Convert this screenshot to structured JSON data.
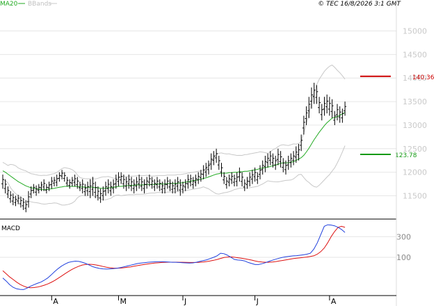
{
  "header": {
    "legend_ma": "MA20",
    "legend_bbands": "BBands",
    "copyright": "© TEC 16/8/2026 3:1 GMT"
  },
  "macd_label": "MACD",
  "colors": {
    "price_bars": "#000000",
    "ma20": "#22aa22",
    "bbands": "#c8c8c8",
    "resistance": "#cc0000",
    "support": "#119911",
    "macd_line": "#1f3fdd",
    "signal_line": "#dd1111",
    "grid": "#e6e6e6"
  },
  "chart_data": [
    {
      "type": "ohlc",
      "title": "",
      "xlabel": "",
      "ylabel": "",
      "ylim": [
        11050,
        15450
      ],
      "yticks": [
        "11500",
        "12000",
        "12500",
        "13000",
        "13500",
        "14000",
        "14500",
        "15000"
      ],
      "grid": true,
      "x_month_labels": [
        {
          "label": "A",
          "index": 19
        },
        {
          "label": "M",
          "index": 45
        },
        {
          "label": "J",
          "index": 70
        },
        {
          "label": "J",
          "index": 98
        },
        {
          "label": "A",
          "index": 127
        }
      ],
      "bars": [
        [
          11950,
          11650
        ],
        [
          11850,
          11550
        ],
        [
          11700,
          11450
        ],
        [
          11600,
          11350
        ],
        [
          11550,
          11300
        ],
        [
          11500,
          11280
        ],
        [
          11520,
          11320
        ],
        [
          11480,
          11250
        ],
        [
          11450,
          11200
        ],
        [
          11400,
          11150
        ],
        [
          11600,
          11250
        ],
        [
          11700,
          11450
        ],
        [
          11750,
          11550
        ],
        [
          11720,
          11500
        ],
        [
          11750,
          11550
        ],
        [
          11800,
          11600
        ],
        [
          11850,
          11600
        ],
        [
          11750,
          11550
        ],
        [
          11800,
          11600
        ],
        [
          11900,
          11650
        ],
        [
          11900,
          11700
        ],
        [
          11950,
          11700
        ],
        [
          12000,
          11800
        ],
        [
          12050,
          11850
        ],
        [
          12000,
          11800
        ],
        [
          11900,
          11700
        ],
        [
          11850,
          11650
        ],
        [
          11900,
          11700
        ],
        [
          11950,
          11700
        ],
        [
          11900,
          11650
        ],
        [
          11800,
          11600
        ],
        [
          11850,
          11550
        ],
        [
          11750,
          11500
        ],
        [
          11800,
          11500
        ],
        [
          11850,
          11450
        ],
        [
          11900,
          11500
        ],
        [
          11800,
          11450
        ],
        [
          11700,
          11400
        ],
        [
          11650,
          11350
        ],
        [
          11700,
          11400
        ],
        [
          11800,
          11500
        ],
        [
          11850,
          11550
        ],
        [
          11800,
          11500
        ],
        [
          11850,
          11550
        ],
        [
          11950,
          11650
        ],
        [
          12000,
          11700
        ],
        [
          12000,
          11750
        ],
        [
          11950,
          11650
        ],
        [
          11900,
          11600
        ],
        [
          11950,
          11650
        ],
        [
          11900,
          11600
        ],
        [
          11850,
          11550
        ],
        [
          11900,
          11600
        ],
        [
          11950,
          11650
        ],
        [
          11900,
          11600
        ],
        [
          11850,
          11550
        ],
        [
          11900,
          11650
        ],
        [
          11950,
          11700
        ],
        [
          11900,
          11650
        ],
        [
          11850,
          11600
        ],
        [
          11900,
          11650
        ],
        [
          11850,
          11600
        ],
        [
          11800,
          11550
        ],
        [
          11850,
          11550
        ],
        [
          11900,
          11650
        ],
        [
          11850,
          11600
        ],
        [
          11800,
          11550
        ],
        [
          11850,
          11550
        ],
        [
          11900,
          11600
        ],
        [
          11850,
          11500
        ],
        [
          11800,
          11550
        ],
        [
          11850,
          11600
        ],
        [
          11950,
          11650
        ],
        [
          11950,
          11700
        ],
        [
          11900,
          11650
        ],
        [
          11950,
          11700
        ],
        [
          12000,
          11750
        ],
        [
          12050,
          11800
        ],
        [
          12150,
          11850
        ],
        [
          12200,
          11900
        ],
        [
          12250,
          11950
        ],
        [
          12400,
          12050
        ],
        [
          12450,
          12150
        ],
        [
          12500,
          12200
        ],
        [
          12350,
          12050
        ],
        [
          12200,
          11900
        ],
        [
          12000,
          11750
        ],
        [
          11900,
          11650
        ],
        [
          11950,
          11700
        ],
        [
          12000,
          11750
        ],
        [
          11950,
          11700
        ],
        [
          12000,
          11700
        ],
        [
          12100,
          11800
        ],
        [
          12000,
          11700
        ],
        [
          11850,
          11600
        ],
        [
          11900,
          11650
        ],
        [
          12000,
          11700
        ],
        [
          12050,
          11750
        ],
        [
          12100,
          11800
        ],
        [
          12000,
          11750
        ],
        [
          12150,
          11850
        ],
        [
          12250,
          11950
        ],
        [
          12350,
          12000
        ],
        [
          12400,
          12100
        ],
        [
          12450,
          12150
        ],
        [
          12400,
          12100
        ],
        [
          12350,
          12050
        ],
        [
          12500,
          12150
        ],
        [
          12450,
          12100
        ],
        [
          12300,
          12000
        ],
        [
          12250,
          11950
        ],
        [
          12350,
          12050
        ],
        [
          12400,
          12100
        ],
        [
          12450,
          12150
        ],
        [
          12550,
          12200
        ],
        [
          12600,
          12250
        ],
        [
          12800,
          12450
        ],
        [
          13200,
          12800
        ],
        [
          13400,
          13000
        ],
        [
          13600,
          13150
        ],
        [
          13800,
          13350
        ],
        [
          13900,
          13450
        ],
        [
          13850,
          13450
        ],
        [
          13600,
          13250
        ],
        [
          13450,
          13100
        ],
        [
          13600,
          13200
        ],
        [
          13650,
          13250
        ],
        [
          13600,
          13200
        ],
        [
          13550,
          13150
        ],
        [
          13300,
          13000
        ],
        [
          13450,
          13100
        ],
        [
          13400,
          13050
        ],
        [
          13350,
          13050
        ],
        [
          13500,
          13200
        ]
      ],
      "ma20": [
        12030,
        12000,
        11960,
        11920,
        11880,
        11840,
        11800,
        11770,
        11740,
        11710,
        11690,
        11670,
        11660,
        11650,
        11640,
        11630,
        11630,
        11630,
        11640,
        11650,
        11660,
        11670,
        11680,
        11690,
        11700,
        11700,
        11700,
        11700,
        11700,
        11700,
        11690,
        11690,
        11680,
        11680,
        11680,
        11680,
        11670,
        11670,
        11660,
        11660,
        11660,
        11670,
        11670,
        11680,
        11690,
        11700,
        11700,
        11710,
        11710,
        11720,
        11720,
        11720,
        11730,
        11730,
        11730,
        11730,
        11740,
        11740,
        11740,
        11740,
        11750,
        11750,
        11750,
        11750,
        11760,
        11760,
        11760,
        11760,
        11770,
        11770,
        11780,
        11790,
        11800,
        11810,
        11820,
        11830,
        11840,
        11850,
        11870,
        11880,
        11900,
        11920,
        11940,
        11960,
        11970,
        11980,
        11980,
        11980,
        11990,
        11990,
        12000,
        12000,
        12010,
        12010,
        12020,
        12020,
        12030,
        12040,
        12050,
        12060,
        12080,
        12090,
        12100,
        12110,
        12120,
        12140,
        12150,
        12170,
        12190,
        12200,
        12200,
        12200,
        12210,
        12230,
        12250,
        12280,
        12310,
        12360,
        12430,
        12510,
        12600,
        12690,
        12770,
        12850,
        12920,
        12990,
        13050,
        13100,
        13150,
        13160,
        13180,
        13210,
        13240,
        13270
      ],
      "resistance": {
        "value": 14036,
        "label": "140.36"
      },
      "support": {
        "value": 12378,
        "label": "123.78"
      }
    },
    {
      "type": "line",
      "title": "MACD",
      "yticks": [
        "100",
        "300"
      ],
      "ylim": [
        -250,
        450
      ],
      "series": [
        {
          "name": "MACD",
          "values": [
            -100,
            -130,
            -165,
            -190,
            -205,
            -210,
            -212,
            -198,
            -180,
            -165,
            -152,
            -140,
            -122,
            -100,
            -70,
            -38,
            -10,
            15,
            35,
            50,
            58,
            63,
            60,
            52,
            40,
            25,
            10,
            0,
            -8,
            -12,
            -14,
            -12,
            -10,
            -6,
            0,
            8,
            16,
            24,
            32,
            40,
            44,
            48,
            52,
            54,
            56,
            58,
            58,
            56,
            54,
            52,
            52,
            50,
            48,
            46,
            44,
            46,
            52,
            60,
            68,
            76,
            88,
            100,
            115,
            140,
            135,
            120,
            100,
            80,
            74,
            72,
            65,
            50,
            40,
            30,
            30,
            38,
            48,
            60,
            72,
            82,
            92,
            100,
            106,
            110,
            114,
            116,
            120,
            124,
            130,
            140,
            180,
            240,
            320,
            400,
            415,
            412,
            405,
            390,
            370,
            340
          ],
          "x_start": 0
        },
        {
          "name": "Signal",
          "values": [
            -30,
            -60,
            -90,
            -115,
            -140,
            -162,
            -178,
            -190,
            -194,
            -193,
            -188,
            -180,
            -170,
            -158,
            -142,
            -124,
            -103,
            -81,
            -59,
            -37,
            -17,
            0,
            14,
            25,
            31,
            33,
            31,
            26,
            19,
            11,
            4,
            -1,
            -4,
            -5,
            -4,
            -1,
            3,
            8,
            14,
            20,
            26,
            31,
            36,
            40,
            44,
            47,
            50,
            52,
            53,
            53,
            53,
            52,
            52,
            51,
            50,
            50,
            50,
            52,
            55,
            59,
            64,
            71,
            79,
            89,
            98,
            103,
            104,
            101,
            96,
            91,
            86,
            80,
            73,
            65,
            58,
            54,
            52,
            52,
            55,
            59,
            64,
            70,
            76,
            82,
            87,
            91,
            95,
            99,
            103,
            108,
            115,
            130,
            155,
            190,
            240,
            300,
            350,
            390,
            400,
            390
          ],
          "x_start": 0
        }
      ]
    }
  ]
}
